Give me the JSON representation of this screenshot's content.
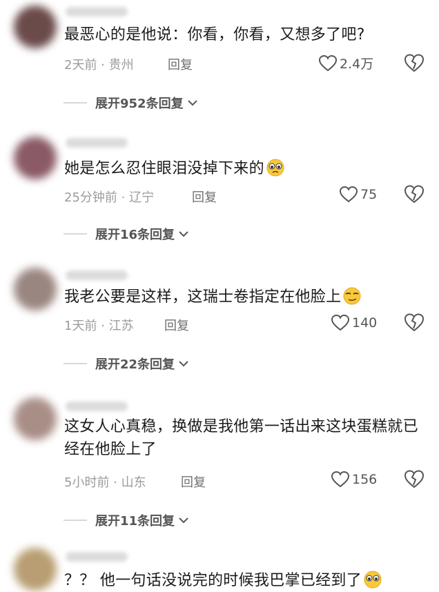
{
  "comments": [
    {
      "text": "最恶心的是他说：你看，你看，又想多了吧?",
      "meta": "2天前 · 贵州",
      "reply_label": "回复",
      "likes": "2.4万",
      "expand_label": "展开952条回复",
      "avatar_color": "#6b4a4a"
    },
    {
      "text": "她是怎么忍住眼泪没掉下来的",
      "emoji": "pleading-face-icon",
      "meta": "25分钟前 · 辽宁",
      "reply_label": "回复",
      "likes": "75",
      "expand_label": "展开16条回复",
      "avatar_color": "#8a5a66"
    },
    {
      "text": "我老公要是这样，这瑞士卷指定在他脸上",
      "emoji": "smirk-face-icon",
      "meta": "1天前 · 江苏",
      "reply_label": "回复",
      "likes": "140",
      "expand_label": "展开22条回复",
      "avatar_color": "#9a8680"
    },
    {
      "text": "这女人心真稳，换做是我他第一话出来这块蛋糕就已经在他脸上了",
      "meta": "5小时前 · 山东",
      "reply_label": "回复",
      "likes": "156",
      "expand_label": "展开11条回复",
      "avatar_color": "#a88e86"
    },
    {
      "text": "？？ 他一句话没说完的时候我巴掌已经到了",
      "emoji": "pleading-face-icon",
      "avatar_color": "#b89e72"
    }
  ]
}
